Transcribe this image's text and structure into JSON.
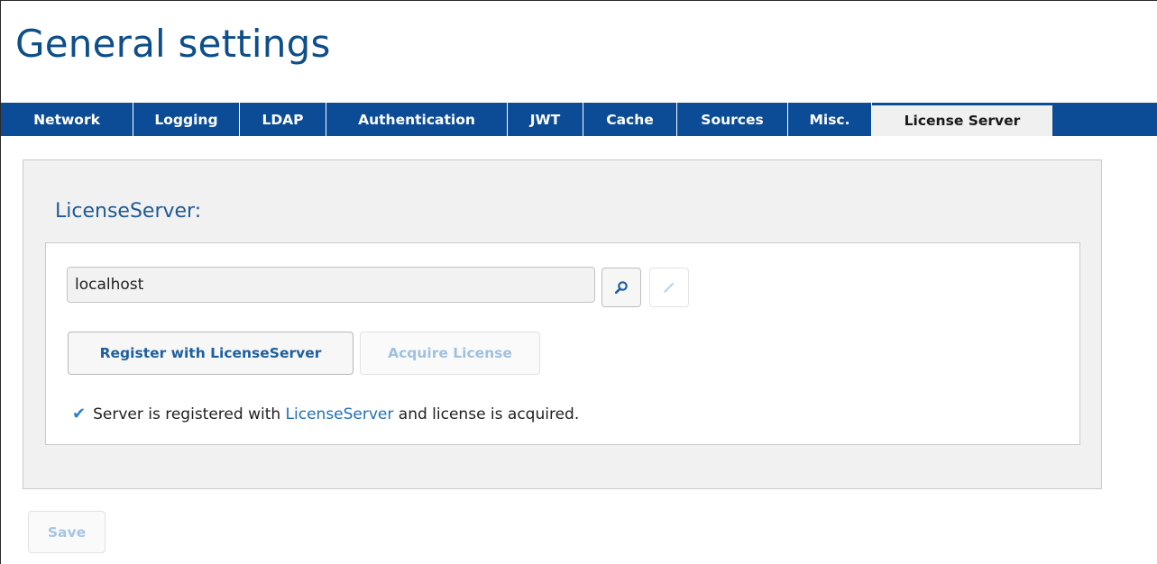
{
  "page": {
    "title": "General settings"
  },
  "tabs": [
    {
      "label": "Network",
      "active": false
    },
    {
      "label": "Logging",
      "active": false
    },
    {
      "label": "LDAP",
      "active": false
    },
    {
      "label": "Authentication",
      "active": false
    },
    {
      "label": "JWT",
      "active": false
    },
    {
      "label": "Cache",
      "active": false
    },
    {
      "label": "Sources",
      "active": false
    },
    {
      "label": "Misc.",
      "active": false
    },
    {
      "label": "License Server",
      "active": true
    }
  ],
  "license_server": {
    "section_title": "LicenseServer:",
    "server_value": "localhost",
    "search_icon": "search-icon",
    "edit_icon": "pencil-icon",
    "register_label": "Register with LicenseServer",
    "acquire_label": "Acquire License",
    "status": {
      "icon": "checkmark-icon",
      "prefix": "Server is registered with",
      "link": "LicenseServer",
      "suffix": "and license is acquired."
    }
  },
  "actions": {
    "save_label": "Save"
  },
  "colors": {
    "tabbar": "#0c4c96",
    "title": "#0e4f8a",
    "link": "#1f6fb6",
    "disabled_text": "#a6c6e2"
  }
}
